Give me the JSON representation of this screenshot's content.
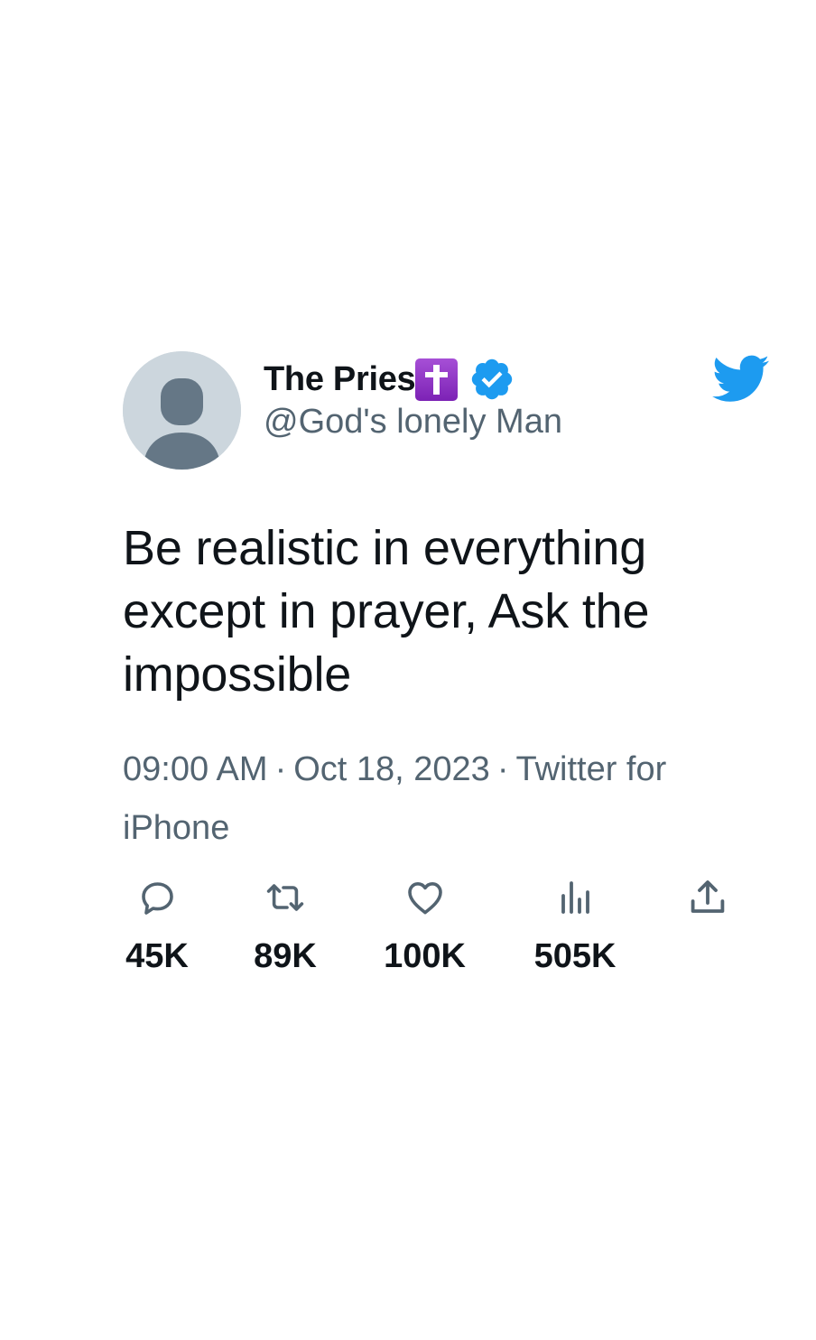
{
  "user": {
    "display_name": "The Pries",
    "display_name_emoji": "cross-emoji",
    "verified_icon": "verified-badge-icon",
    "handle": "@God's lonely Man",
    "avatar_icon": "default-avatar-icon"
  },
  "brand": {
    "icon": "twitter-bird-icon",
    "color": "#1d9bf0"
  },
  "tweet": {
    "text": "Be realistic in everything except in prayer, Ask the impossible"
  },
  "meta": {
    "time": "09:00 AM",
    "separator": "·",
    "date": "Oct 18, 2023",
    "source": "Twitter for iPhone"
  },
  "actions": {
    "replies": {
      "icon": "reply-icon",
      "count": "45K"
    },
    "retweets": {
      "icon": "retweet-icon",
      "count": "89K"
    },
    "likes": {
      "icon": "heart-icon",
      "count": "100K"
    },
    "views": {
      "icon": "views-icon",
      "count": "505K"
    },
    "share": {
      "icon": "share-icon"
    }
  },
  "colors": {
    "text_primary": "#0f1419",
    "text_secondary": "#536471",
    "verified": "#1d9bf0",
    "avatar_bg": "#ccd6dd",
    "avatar_fg": "#657786"
  }
}
